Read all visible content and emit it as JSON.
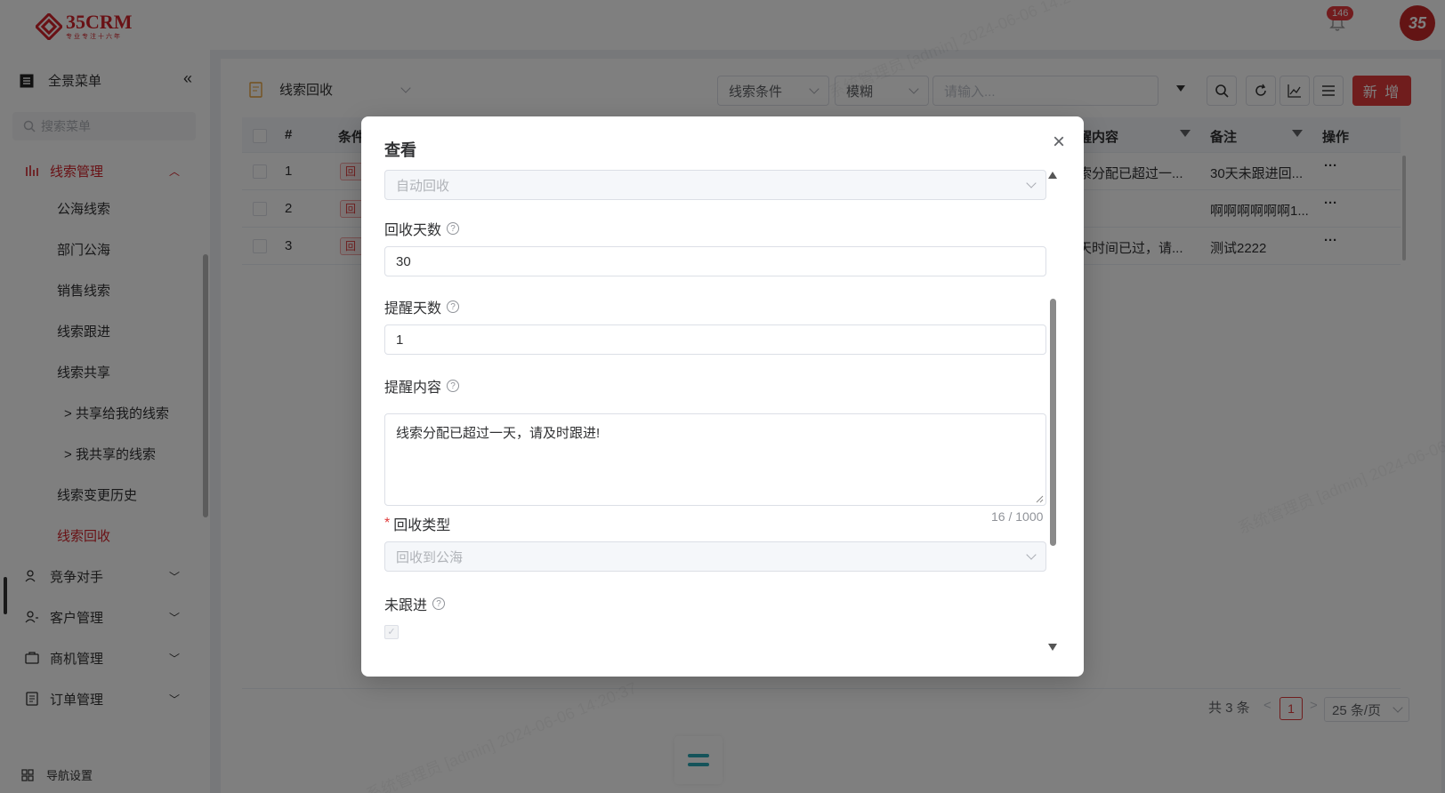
{
  "header": {
    "logo_name": "35CRM",
    "logo_slogan": "专业专注十六年",
    "notification_count": "146",
    "avatar_text": "35"
  },
  "sidebar": {
    "all_menu": "全景菜单",
    "search_placeholder": "搜索菜单",
    "groups": {
      "leads": "线索管理",
      "competitors": "竞争对手",
      "customers": "客户管理",
      "opportunities": "商机管理",
      "orders": "订单管理"
    },
    "sub_items": [
      "公海线索",
      "部门公海",
      "销售线索",
      "线索跟进",
      "线索共享",
      "共享给我的线索",
      "我共享的线索",
      "线索变更历史",
      "线索回收"
    ],
    "nav_setting": "导航设置"
  },
  "toolbar": {
    "view_title": "线索回收",
    "filter_field": "线索条件",
    "filter_mode": "模糊",
    "search_placeholder": "请输入...",
    "new_button": "新 增"
  },
  "table": {
    "headers": {
      "check": "",
      "index": "#",
      "condition": "条件",
      "content": "醒内容",
      "remark": "备注",
      "actions": "操作"
    },
    "rows": [
      {
        "index": "1",
        "tag": "回收",
        "content": "索分配已超过一...",
        "remark": "30天未跟进回...",
        "actions": "···"
      },
      {
        "index": "2",
        "tag": "回收",
        "content": "",
        "remark": "啊啊啊啊啊啊1...",
        "actions": "···"
      },
      {
        "index": "3",
        "tag": "回收",
        "content": "天时间已过，请...",
        "remark": "测试2222",
        "actions": "···"
      }
    ]
  },
  "pagination": {
    "total": "共 3 条",
    "current": "1",
    "page_size": "25 条/页"
  },
  "dialog": {
    "title": "查看",
    "close": "×",
    "top_select_value": "自动回收",
    "recycle_days_label": "回收天数",
    "recycle_days_value": "30",
    "remind_days_label": "提醒天数",
    "remind_days_value": "1",
    "remind_content_label": "提醒内容",
    "remind_content_value": "线索分配已超过一天，请及时跟进!",
    "char_count": "16 / 1000",
    "recycle_type_label": "回收类型",
    "recycle_type_value": "回收到公海",
    "not_followed_label": "未跟进"
  },
  "watermark_text": "系统管理员 [admin] 2024-06-06 14:20:37",
  "colors": {
    "brand_red": "#d2232a",
    "button_red": "#e03b3b",
    "teal": "#2aa6b4"
  }
}
